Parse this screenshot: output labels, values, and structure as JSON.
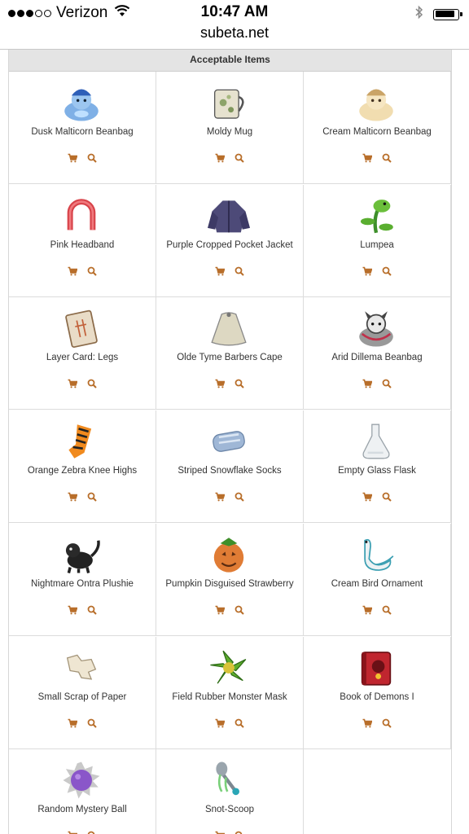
{
  "status": {
    "carrier": "Verizon",
    "time": "10:47 AM",
    "signal_filled": 3,
    "signal_total": 5
  },
  "browser": {
    "url": "subeta.net"
  },
  "section": {
    "title": "Acceptable Items"
  },
  "colors": {
    "accent": "#b86e2a",
    "header_bg": "#e4e4e4"
  },
  "items": [
    {
      "name": "Dusk Malticorn Beanbag",
      "icon": "blue-malticorn-beanbag-icon"
    },
    {
      "name": "Moldy Mug",
      "icon": "moldy-mug-icon"
    },
    {
      "name": "Cream Malticorn Beanbag",
      "icon": "cream-malticorn-beanbag-icon"
    },
    {
      "name": "Pink Headband",
      "icon": "pink-headband-icon"
    },
    {
      "name": "Purple Cropped Pocket Jacket",
      "icon": "purple-jacket-icon"
    },
    {
      "name": "Lumpea",
      "icon": "lumpea-plant-icon"
    },
    {
      "name": "Layer Card: Legs",
      "icon": "layer-card-icon"
    },
    {
      "name": "Olde Tyme Barbers Cape",
      "icon": "barber-cape-icon"
    },
    {
      "name": "Arid Dillema Beanbag",
      "icon": "dillema-beanbag-icon"
    },
    {
      "name": "Orange Zebra Knee Highs",
      "icon": "zebra-socks-icon"
    },
    {
      "name": "Striped Snowflake Socks",
      "icon": "snowflake-socks-icon"
    },
    {
      "name": "Empty Glass Flask",
      "icon": "glass-flask-icon"
    },
    {
      "name": "Nightmare Ontra Plushie",
      "icon": "ontra-plushie-icon"
    },
    {
      "name": "Pumpkin Disguised Strawberry",
      "icon": "pumpkin-strawberry-icon"
    },
    {
      "name": "Cream Bird Ornament",
      "icon": "bird-ornament-icon"
    },
    {
      "name": "Small Scrap of Paper",
      "icon": "paper-scrap-icon"
    },
    {
      "name": "Field Rubber Monster Mask",
      "icon": "monster-mask-icon"
    },
    {
      "name": "Book of Demons I",
      "icon": "demon-book-icon"
    },
    {
      "name": "Random Mystery Ball",
      "icon": "mystery-ball-icon"
    },
    {
      "name": "Snot-Scoop",
      "icon": "snot-scoop-icon"
    }
  ]
}
